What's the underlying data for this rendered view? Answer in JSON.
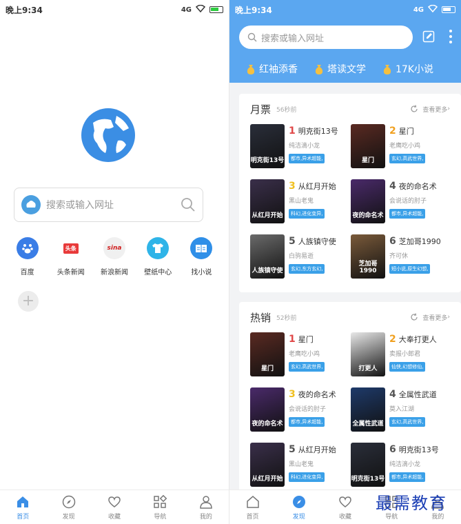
{
  "left": {
    "status": {
      "time": "晚上9:34",
      "signal": "4G"
    },
    "search_placeholder": "搜索或输入网址",
    "shortcuts": [
      {
        "label": "百度",
        "icon": "baidu-paw-icon",
        "color": "#3a7de6",
        "glyph": ""
      },
      {
        "label": "头条新闻",
        "icon": "toutiao-icon",
        "color": "#e83a3a",
        "glyph": "头条"
      },
      {
        "label": "新浪新闻",
        "icon": "sina-icon",
        "color": "#f0f0f0",
        "glyph": "sina"
      },
      {
        "label": "壁纸中心",
        "icon": "tshirt-icon",
        "color": "#2fb4e8",
        "glyph": ""
      },
      {
        "label": "找小说",
        "icon": "book-icon",
        "color": "#2f8fe8",
        "glyph": ""
      }
    ],
    "add_label": "+",
    "nav": [
      {
        "label": "首页",
        "icon": "home-icon",
        "active": true
      },
      {
        "label": "发现",
        "icon": "compass-icon",
        "active": false
      },
      {
        "label": "收藏",
        "icon": "heart-icon",
        "active": false
      },
      {
        "label": "导航",
        "icon": "grid-icon",
        "active": false
      },
      {
        "label": "我的",
        "icon": "user-icon",
        "active": false
      }
    ]
  },
  "right": {
    "status": {
      "time": "晚上9:34",
      "signal": "4G"
    },
    "search_placeholder": "搜索或输入网址",
    "recommend": [
      "红袖添香",
      "塔读文学",
      "17K小说"
    ],
    "sections": [
      {
        "title": "月票",
        "ago": "56秒前",
        "more": "查看更多",
        "books": [
          {
            "rank": "1",
            "name": "明克街13号",
            "author": "纯洁滴小龙",
            "tag": "都市,异术超能,",
            "cover_color": "#2a2e3a",
            "cover_text": "明克街13号"
          },
          {
            "rank": "2",
            "name": "星门",
            "author": "老鹰吃小鸡",
            "tag": "玄幻,高武世界,",
            "cover_color": "#5a2a22",
            "cover_text": "星门"
          },
          {
            "rank": "3",
            "name": "从红月开始",
            "author": "黑山老鬼",
            "tag": "科幻,进化变异,",
            "cover_color": "#3a2f4a",
            "cover_text": "从红月开始"
          },
          {
            "rank": "4",
            "name": "夜的命名术",
            "author": "会说话的肘子",
            "tag": "都市,异术超能,",
            "cover_color": "#4a2a6a",
            "cover_text": "夜的命名术"
          },
          {
            "rank": "5",
            "name": "人族镇守使",
            "author": "白驹易逝",
            "tag": "玄幻,东方玄幻,",
            "cover_color": "#6a6a6a",
            "cover_text": "人族镇守使"
          },
          {
            "rank": "6",
            "name": "芝加哥1990",
            "author": "齐可休",
            "tag": "短小说,原生幻想,",
            "cover_color": "#7a5a3a",
            "cover_text": "芝加哥1990"
          }
        ]
      },
      {
        "title": "热销",
        "ago": "52秒前",
        "more": "查看更多",
        "books": [
          {
            "rank": "1",
            "name": "星门",
            "author": "老鹰吃小鸡",
            "tag": "玄幻,高武世界,",
            "cover_color": "#5a2a22",
            "cover_text": "星门"
          },
          {
            "rank": "2",
            "name": "大奉打更人",
            "author": "卖报小郎君",
            "tag": "仙侠,幻想修仙,",
            "cover_color": "#e8e8e8",
            "cover_text": "打更人"
          },
          {
            "rank": "3",
            "name": "夜的命名术",
            "author": "会说话的肘子",
            "tag": "都市,异术超能,",
            "cover_color": "#4a2a6a",
            "cover_text": "夜的命名术"
          },
          {
            "rank": "4",
            "name": "全属性武道",
            "author": "莫入江湖",
            "tag": "玄幻,高武世界,",
            "cover_color": "#1e3a6a",
            "cover_text": "全属性武道"
          },
          {
            "rank": "5",
            "name": "从红月开始",
            "author": "黑山老鬼",
            "tag": "科幻,进化变异,",
            "cover_color": "#3a2f4a",
            "cover_text": "从红月开始"
          },
          {
            "rank": "6",
            "name": "明克街13号",
            "author": "纯洁滴小龙",
            "tag": "都市,异术超能,",
            "cover_color": "#2a2e3a",
            "cover_text": "明克街13号"
          }
        ]
      }
    ],
    "nav": [
      {
        "label": "首页",
        "icon": "home-icon",
        "active": false
      },
      {
        "label": "发现",
        "icon": "compass-icon",
        "active": true
      },
      {
        "label": "收藏",
        "icon": "heart-icon",
        "active": false
      },
      {
        "label": "导航",
        "icon": "grid-icon",
        "active": false
      },
      {
        "label": "我的",
        "icon": "user-icon",
        "active": false
      }
    ]
  },
  "watermark": "最需教育",
  "colors": {
    "accent": "#3a8ee6",
    "header": "#5ba7f0",
    "tag": "#3aa0e8"
  }
}
